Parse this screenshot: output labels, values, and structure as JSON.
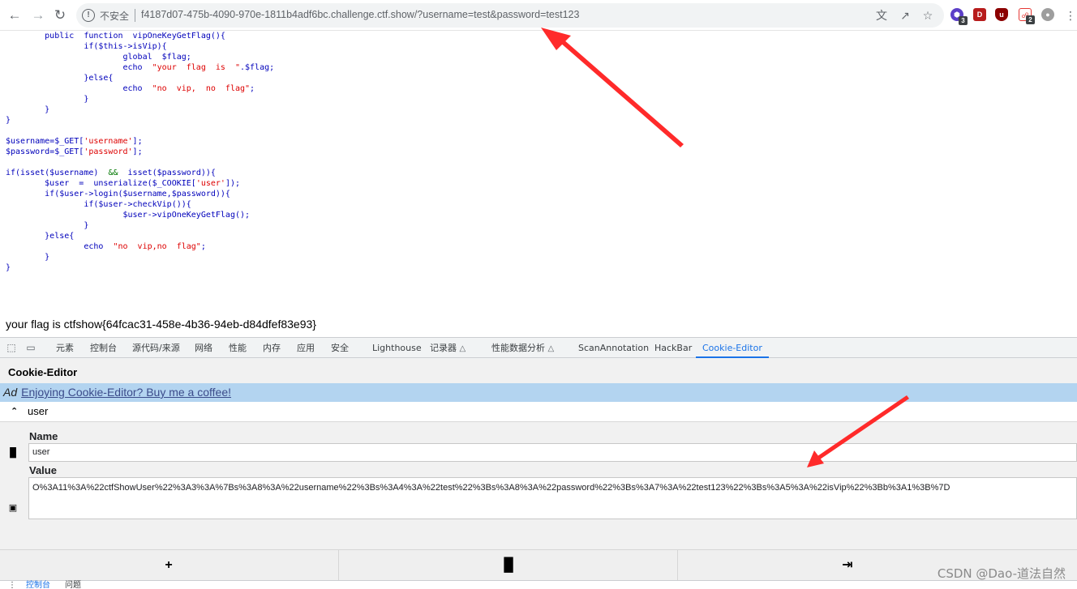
{
  "browser": {
    "security_label": "不安全",
    "url": "f4187d07-475b-4090-970e-1811b4adf6bc.challenge.ctf.show/?username=test&password=test123",
    "extensions": [
      {
        "icon": "hexagon-extension-icon",
        "badge": "3",
        "color": "#5c3fc8"
      },
      {
        "icon": "red-square-extension-icon",
        "badge": "",
        "color": "#b71c1c"
      },
      {
        "icon": "ublock-shield-icon",
        "badge": "",
        "color": "#8b0000"
      },
      {
        "icon": "link-extension-icon",
        "badge": "2",
        "color": "#e53935"
      },
      {
        "icon": "globe-extension-icon",
        "badge": "",
        "color": "#9e9e9e"
      }
    ]
  },
  "page": {
    "flag_output": "your flag is ctfshow{64fcac31-458e-4b36-94eb-d84dfef83e93}"
  },
  "devtools": {
    "tabs": [
      {
        "label": "元素"
      },
      {
        "label": "控制台"
      },
      {
        "label": "源代码/来源"
      },
      {
        "label": "网络"
      },
      {
        "label": "性能"
      },
      {
        "label": "内存"
      },
      {
        "label": "应用"
      },
      {
        "label": "安全"
      },
      {
        "label": "Lighthouse"
      },
      {
        "label": "记录器"
      },
      {
        "label": "性能数据分析"
      },
      {
        "label": "ScanAnnotation"
      },
      {
        "label": "HackBar"
      },
      {
        "label": "Cookie-Editor"
      }
    ],
    "active_tab": "Cookie-Editor",
    "drawer_tabs": [
      "控制台",
      "问题"
    ]
  },
  "cookie_editor": {
    "title": "Cookie-Editor",
    "ad_tag": "Ad",
    "ad_text": "Enjoying Cookie-Editor? Buy me a coffee!",
    "cookie_name_header": "user",
    "name_label": "Name",
    "name_value": "user",
    "value_label": "Value",
    "value_value": "O%3A11%3A%22ctfShowUser%22%3A3%3A%7Bs%3A8%3A%22username%22%3Bs%3A4%3A%22test%22%3Bs%3A8%3A%22password%22%3Bs%3A7%3A%22test123%22%3Bs%3A5%3A%22isVip%22%3Bb%3A1%3B%7D"
  },
  "watermark": "CSDN @Dao-道法自然",
  "colors": {
    "accent": "#1a73e8",
    "ad_background": "#b3d4f0",
    "annotation_arrow": "#ff2a2a"
  }
}
